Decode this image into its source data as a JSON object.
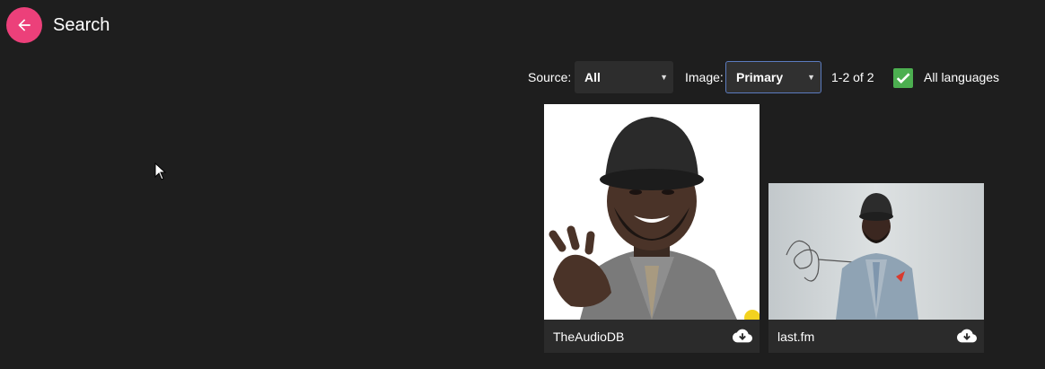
{
  "header": {
    "title": "Search"
  },
  "filters": {
    "source_label": "Source:",
    "source_value": "All",
    "image_label": "Image:",
    "image_value": "Primary",
    "result_count": "1-2 of 2",
    "all_languages_label": "All languages",
    "all_languages_checked": true
  },
  "results": [
    {
      "provider": "TheAudioDB",
      "icon": "cloud-download-icon"
    },
    {
      "provider": "last.fm",
      "icon": "cloud-download-icon"
    }
  ],
  "colors": {
    "accent": "#ec407a",
    "checkbox": "#4caf50",
    "background": "#1e1e1e",
    "card": "#2b2b2b"
  }
}
